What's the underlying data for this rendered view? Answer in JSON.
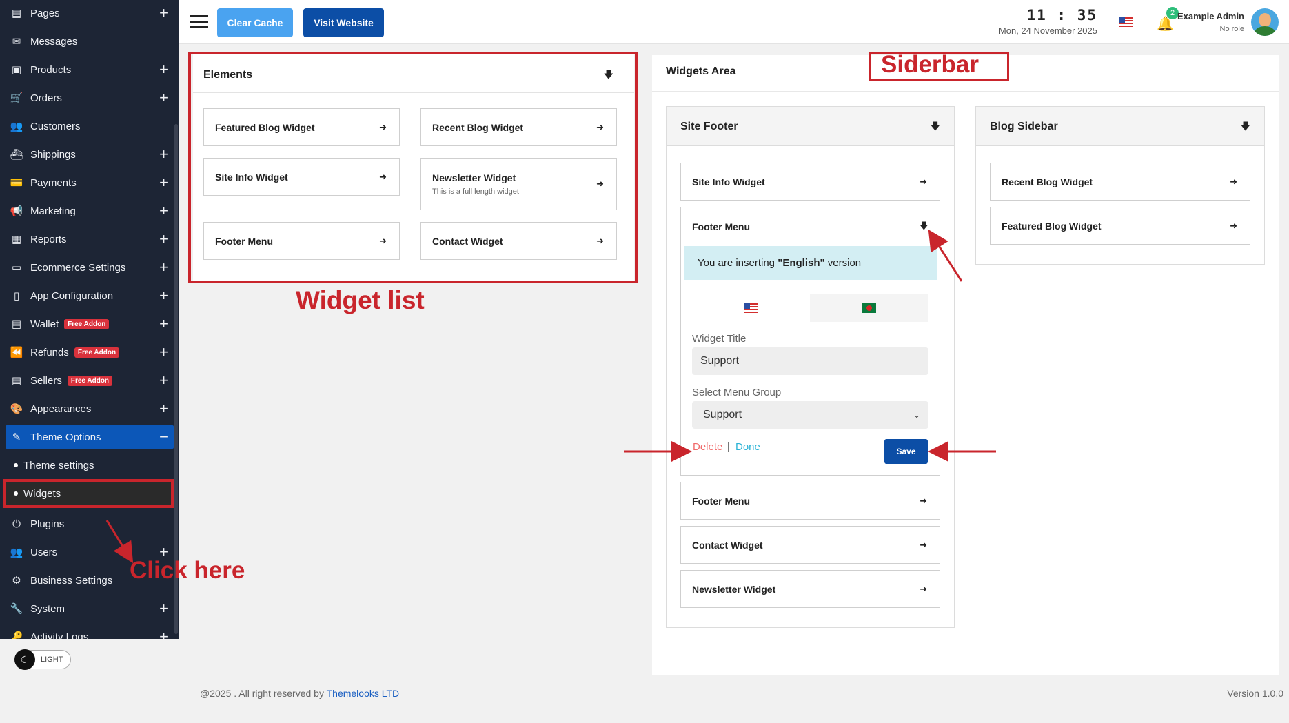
{
  "sidebar": {
    "items": [
      {
        "label": "Pages",
        "icon": "page-icon",
        "plus": "+"
      },
      {
        "label": "Messages",
        "icon": "inbox-icon",
        "plus": ""
      },
      {
        "label": "Products",
        "icon": "box-icon",
        "plus": "+"
      },
      {
        "label": "Orders",
        "icon": "cart-icon",
        "plus": "+"
      },
      {
        "label": "Customers",
        "icon": "users-icon",
        "plus": ""
      },
      {
        "label": "Shippings",
        "icon": "ship-icon",
        "plus": "+"
      },
      {
        "label": "Payments",
        "icon": "payment-icon",
        "plus": "+"
      },
      {
        "label": "Marketing",
        "icon": "megaphone-icon",
        "plus": "+"
      },
      {
        "label": "Reports",
        "icon": "report-icon",
        "plus": "+"
      },
      {
        "label": "Ecommerce Settings",
        "icon": "window-icon",
        "plus": "+"
      },
      {
        "label": "App Configuration",
        "icon": "mobile-icon",
        "plus": "+"
      },
      {
        "label": "Wallet",
        "icon": "wallet-icon",
        "plus": "+",
        "badge": "Free Addon"
      },
      {
        "label": "Refunds",
        "icon": "rewind-icon",
        "plus": "+",
        "badge": "Free Addon"
      },
      {
        "label": "Sellers",
        "icon": "store-icon",
        "plus": "+",
        "badge": "Free Addon"
      },
      {
        "label": "Appearances",
        "icon": "palette-icon",
        "plus": "+"
      }
    ],
    "active": {
      "label": "Theme Options",
      "icon": "brush-icon",
      "minus": "−"
    },
    "subitems": [
      {
        "label": "Theme settings"
      },
      {
        "label": "Widgets"
      }
    ],
    "items_after": [
      {
        "label": "Plugins",
        "icon": "plug-icon",
        "plus": ""
      },
      {
        "label": "Users",
        "icon": "users-icon",
        "plus": "+"
      },
      {
        "label": "Business Settings",
        "icon": "gears-icon",
        "plus": ""
      },
      {
        "label": "System",
        "icon": "wrench-icon",
        "plus": "+"
      },
      {
        "label": "Activity Logs",
        "icon": "key-icon",
        "plus": "+"
      }
    ],
    "theme_toggle": "LIGHT"
  },
  "header": {
    "clear_cache": "Clear Cache",
    "visit_website": "Visit Website",
    "time": "11 : 35",
    "date": "Mon, 24 November 2025",
    "notifications": "2",
    "admin_name": "Example Admin",
    "admin_role": "No role"
  },
  "elements": {
    "title": "Elements",
    "widgets": [
      {
        "label": "Featured Blog Widget"
      },
      {
        "label": "Recent Blog Widget"
      },
      {
        "label": "Site Info Widget"
      },
      {
        "label": "Newsletter Widget",
        "sub": "This is a full length widget"
      },
      {
        "label": "Footer Menu"
      },
      {
        "label": "Contact Widget"
      }
    ]
  },
  "widgets_area": {
    "title": "Widgets Area",
    "site_footer": {
      "title": "Site Footer",
      "items": [
        "Site Info Widget",
        "Footer Menu",
        "Footer Menu",
        "Contact Widget",
        "Newsletter Widget"
      ],
      "expanded": {
        "info_prefix": "You are inserting ",
        "info_lang": "\"English\"",
        "info_suffix": " version",
        "widget_title_label": "Widget Title",
        "widget_title_value": "Support",
        "menu_group_label": "Select Menu Group",
        "menu_group_value": "Support",
        "delete": "Delete",
        "separator": "|",
        "done": "Done",
        "save": "Save"
      }
    },
    "blog_sidebar": {
      "title": "Blog Sidebar",
      "items": [
        "Recent Blog Widget",
        "Featured Blog Widget"
      ]
    }
  },
  "annotations": {
    "siderbar": "Siderbar",
    "widget_list": "Widget list",
    "click_here": "Click here",
    "color": "#c9252c"
  },
  "footer": {
    "copy_prefix": "@2025 . All right reserved by ",
    "brand": "Themelooks LTD",
    "version": "Version 1.0.0"
  }
}
